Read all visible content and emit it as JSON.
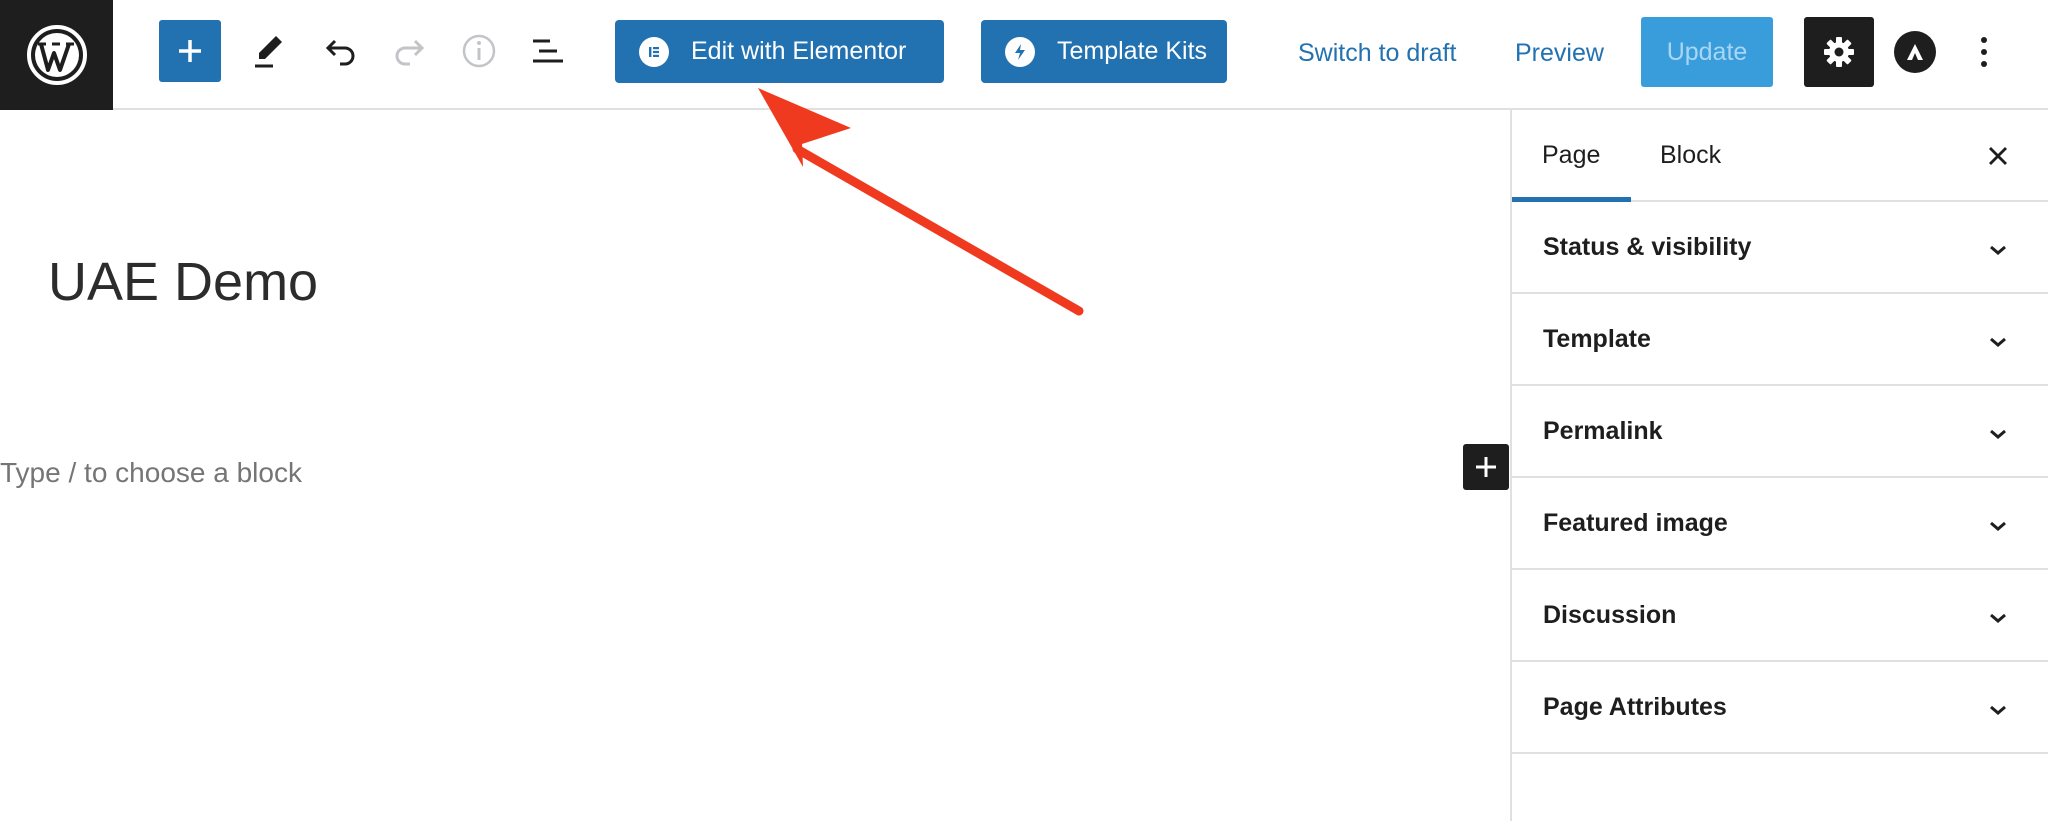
{
  "header": {
    "elementor_button": "Edit with Elementor",
    "template_kits_button": "Template Kits",
    "switch_to_draft": "Switch to draft",
    "preview": "Preview",
    "update": "Update",
    "icons": {
      "logo": "wordpress-logo-icon",
      "add": "plus-icon",
      "tools": "pencil-icon",
      "undo": "undo-icon",
      "redo": "redo-icon",
      "details": "info-icon",
      "list_view": "list-view-icon",
      "elementor": "elementor-icon",
      "template_kits": "template-kits-icon",
      "settings": "gear-icon",
      "astra": "astra-icon",
      "more": "more-vertical-icon"
    },
    "colors": {
      "accent": "#2271b1",
      "update_bg": "#3a9ddb",
      "dark": "#1e1e1e"
    }
  },
  "editor": {
    "title": "UAE Demo",
    "block_placeholder": "Type / to choose a block"
  },
  "sidebar": {
    "tabs": [
      {
        "label": "Page",
        "active": true
      },
      {
        "label": "Block",
        "active": false
      }
    ],
    "panels": [
      {
        "label": "Status & visibility"
      },
      {
        "label": "Template"
      },
      {
        "label": "Permalink"
      },
      {
        "label": "Featured image"
      },
      {
        "label": "Discussion"
      },
      {
        "label": "Page Attributes"
      }
    ]
  },
  "annotation": {
    "arrow_color": "#f03a1f"
  }
}
